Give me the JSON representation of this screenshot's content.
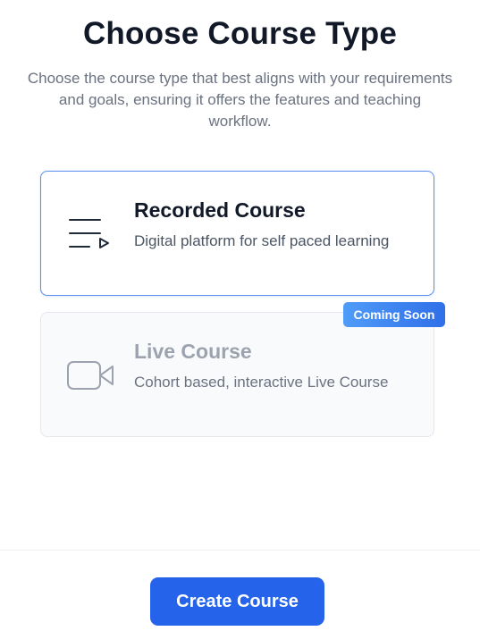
{
  "header": {
    "title": "Choose Course Type",
    "subtitle": "Choose the course type that best aligns with your requirements and goals, ensuring it offers the features and teaching workflow."
  },
  "options": [
    {
      "title": "Recorded Course",
      "description": "Digital platform for self paced learning",
      "icon": "playlist-play-icon",
      "selected": true,
      "enabled": true
    },
    {
      "title": "Live Course",
      "description": "Cohort based, interactive Live Course",
      "icon": "video-camera-icon",
      "selected": false,
      "enabled": false,
      "badge": "Coming Soon"
    }
  ],
  "footer": {
    "create_label": "Create Course"
  },
  "colors": {
    "accent": "#2563eb",
    "selected_border": "#5b8def",
    "disabled_text": "#9ca3af"
  }
}
